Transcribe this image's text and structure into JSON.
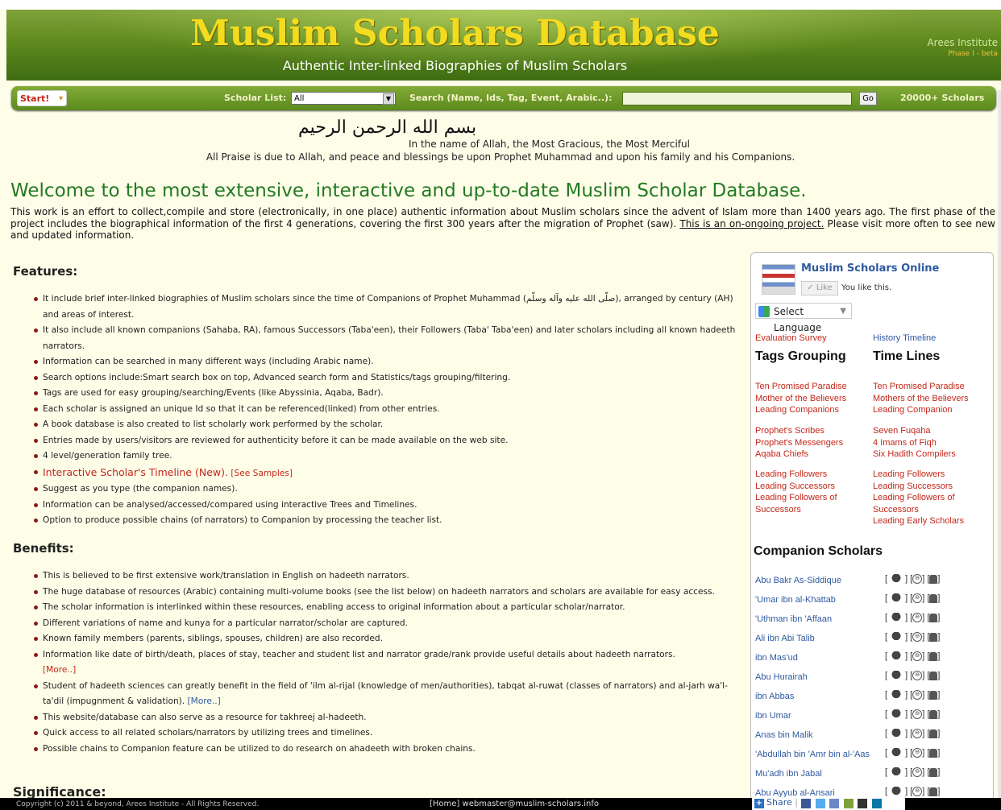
{
  "header": {
    "title": "Muslim Scholars Database",
    "subtitle": "Authentic Inter-linked Biographies of Muslim Scholars",
    "institute": "Arees Institute",
    "phase": "Phase I - beta"
  },
  "nav": {
    "start_label": "Start!",
    "scholar_list_label": "Scholar List:",
    "scholar_list_value": "All",
    "search_label": "Search (Name, Ids, Tag, Event, Arabic..):",
    "search_value": "",
    "go_label": "Go",
    "count_label": "20000+ Scholars"
  },
  "intro_block": {
    "bismillah": "بسم الله الرحمن الرحيم",
    "name_allah": "In the name of Allah, the Most Gracious, the Most Merciful",
    "praise": "All Praise is due to Allah, and peace and blessings be upon Prophet Muhammad and upon his family and his Companions."
  },
  "welcome": {
    "heading": "Welcome to the most extensive, interactive and up-to-date Muslim Scholar Database.",
    "text_1": "This work is an effort to collect,compile and store (electronically, in one place) authentic information about Muslim scholars since the advent of Islam more than 1400 years ago. The first phase of the project includes the biographical information of the first 4 generations, covering the first 300 years after the migration of Prophet (saw). ",
    "text_link": "This is an on-ongoing project.",
    "text_2": " Please visit more often to see new and updated information."
  },
  "features": {
    "heading": "Features:",
    "items": [
      "It include brief inter-linked biographies of Muslim scholars since the time of Companions of Prophet Muhammad (صلّى الله عليه وآله وسلّم), arranged by century (AH) and areas of interest.",
      "It also include all known companions (Sahaba, RA), famous Successors (Taba'een), their Followers (Taba' Taba'een) and later scholars including all known hadeeth narrators.",
      "Information can be searched in many different ways (including Arabic name).",
      "Search options include:Smart search box on top, Advanced search form and Statistics/tags grouping/filtering.",
      "Tags are used for easy grouping/searching/Events (like Abyssinia, Aqaba, Badr).",
      "Each scholar is assigned an unique Id so that it can be referenced(linked) from other entries.",
      "A book database is also created to list scholarly work performed by the scholar.",
      "Entries made by users/visitors are reviewed for authenticity before it can be made available on the web site.",
      "4 level/generation family tree."
    ],
    "timeline_label": "Interactive Scholar's Timeline (New).",
    "samples_label": "[See Samples]",
    "items_after": [
      "Suggest as you type (the companion names).",
      "Information can be analysed/accessed/compared using interactive Trees and Timelines.",
      "Option to produce possible chains (of narrators) to Companion by processing the teacher list."
    ]
  },
  "benefits": {
    "heading": "Benefits:",
    "items": [
      "This is believed to be first extensive work/translation in English on hadeeth narrators.",
      "The huge database of resources (Arabic) containing multi-volume books (see the list below) on hadeeth narrators and scholars are available for easy access.",
      "The scholar information is interlinked within these resources, enabling access to original information about a particular scholar/narrator.",
      "Different variations of name and kunya for a particular narrator/scholar are captured.",
      "Known family members (parents, siblings, spouses, children) are also recorded."
    ],
    "item_info": "Information like date of birth/death, places of stay, teacher and student list and narrator grade/rank provide useful details about hadeeth narrators.",
    "more_1": "[More..]",
    "item_student": "Student of hadeeth sciences can greatly benefit in the field of 'ilm al-rijal (knowledge of men/authorities), tabqat al-ruwat (classes of narrators) and al-jarh wa'l-ta'dil (impugnment & validation).",
    "more_2": "[More..]",
    "items_after": [
      "This website/database can also serve as a resource for takhreej al-hadeeth.",
      "Quick access to all related scholars/narrators by utilizing trees and timelines.",
      "Possible chains to Companion feature can be utilized to do research on ahadeeth with broken chains."
    ]
  },
  "significance": {
    "heading": "Significance:"
  },
  "sidebar": {
    "fb_title": "Muslim Scholars Online",
    "fb_like": "Like",
    "fb_you_like": "You like this.",
    "select_language": "Select Language",
    "eval_survey": "Evaluation Survey",
    "history_timeline": "History Timeline",
    "tags_grouping": "Tags Grouping",
    "time_lines": "Time Lines",
    "left_groups": [
      [
        "Ten Promised Paradise",
        "Mother of the Believers",
        "Leading Companions"
      ],
      [
        "Prophet's Scribes",
        "Prophet's Messengers",
        "Aqaba Chiefs"
      ],
      [
        "Leading Followers",
        "Leading Successors",
        "Leading Followers of",
        "Successors"
      ]
    ],
    "right_groups": [
      [
        "Ten Promised Paradise",
        "Mothers of the Believers",
        "Leading Companion"
      ],
      [
        "Seven Fuqaha",
        "4 Imams of Fiqh",
        "Six Hadith Compilers"
      ],
      [
        "Leading Followers",
        "Leading Successors",
        "Leading Followers of",
        "Successors",
        "Leading Early Scholars"
      ]
    ],
    "companion_heading": "Companion Scholars",
    "companions": [
      "Abu Bakr As-Siddique",
      "'Umar ibn al-Khattab",
      "'Uthman ibn 'Affaan",
      "Ali ibn Abi Talib",
      "ibn Mas'ud",
      "Abu Hurairah",
      "ibn Abbas",
      "ibn Umar",
      "Anas bin Malik",
      "'Abdullah bin 'Amr bin al-'Aas",
      "Mu'adh ibn Jabal",
      "Abu Ayyub al-Ansari"
    ]
  },
  "footer": {
    "copyright": "Copyright (c) 2011 & beyond, Arees Institute - All Rights Reserved.",
    "home": "[Home]",
    "email": "webmaster@muslim-scholars.info",
    "share": "Share"
  },
  "colors": {
    "green_header": "#5f8a1e",
    "title_yellow": "#f3dc20",
    "welcome_green": "#237a23",
    "link_red": "#c3271a",
    "link_blue": "#2f5aa0"
  }
}
